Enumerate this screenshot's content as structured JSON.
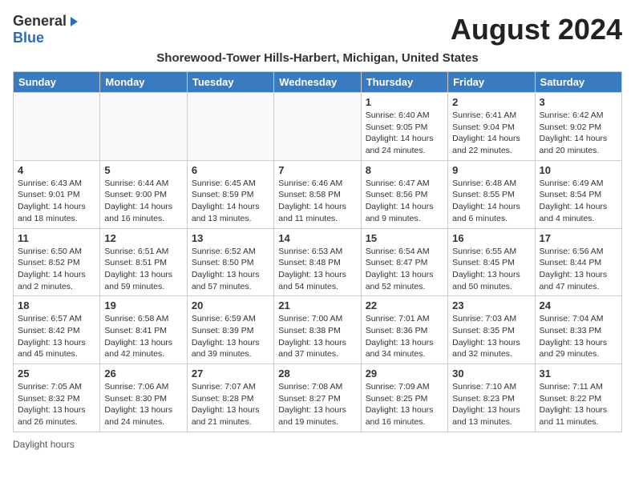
{
  "header": {
    "logo_general": "General",
    "logo_blue": "Blue",
    "month_title": "August 2024",
    "subtitle": "Shorewood-Tower Hills-Harbert, Michigan, United States"
  },
  "calendar": {
    "days_of_week": [
      "Sunday",
      "Monday",
      "Tuesday",
      "Wednesday",
      "Thursday",
      "Friday",
      "Saturday"
    ],
    "weeks": [
      [
        {
          "day": "",
          "detail": ""
        },
        {
          "day": "",
          "detail": ""
        },
        {
          "day": "",
          "detail": ""
        },
        {
          "day": "",
          "detail": ""
        },
        {
          "day": "1",
          "detail": "Sunrise: 6:40 AM\nSunset: 9:05 PM\nDaylight: 14 hours and 24 minutes."
        },
        {
          "day": "2",
          "detail": "Sunrise: 6:41 AM\nSunset: 9:04 PM\nDaylight: 14 hours and 22 minutes."
        },
        {
          "day": "3",
          "detail": "Sunrise: 6:42 AM\nSunset: 9:02 PM\nDaylight: 14 hours and 20 minutes."
        }
      ],
      [
        {
          "day": "4",
          "detail": "Sunrise: 6:43 AM\nSunset: 9:01 PM\nDaylight: 14 hours and 18 minutes."
        },
        {
          "day": "5",
          "detail": "Sunrise: 6:44 AM\nSunset: 9:00 PM\nDaylight: 14 hours and 16 minutes."
        },
        {
          "day": "6",
          "detail": "Sunrise: 6:45 AM\nSunset: 8:59 PM\nDaylight: 14 hours and 13 minutes."
        },
        {
          "day": "7",
          "detail": "Sunrise: 6:46 AM\nSunset: 8:58 PM\nDaylight: 14 hours and 11 minutes."
        },
        {
          "day": "8",
          "detail": "Sunrise: 6:47 AM\nSunset: 8:56 PM\nDaylight: 14 hours and 9 minutes."
        },
        {
          "day": "9",
          "detail": "Sunrise: 6:48 AM\nSunset: 8:55 PM\nDaylight: 14 hours and 6 minutes."
        },
        {
          "day": "10",
          "detail": "Sunrise: 6:49 AM\nSunset: 8:54 PM\nDaylight: 14 hours and 4 minutes."
        }
      ],
      [
        {
          "day": "11",
          "detail": "Sunrise: 6:50 AM\nSunset: 8:52 PM\nDaylight: 14 hours and 2 minutes."
        },
        {
          "day": "12",
          "detail": "Sunrise: 6:51 AM\nSunset: 8:51 PM\nDaylight: 13 hours and 59 minutes."
        },
        {
          "day": "13",
          "detail": "Sunrise: 6:52 AM\nSunset: 8:50 PM\nDaylight: 13 hours and 57 minutes."
        },
        {
          "day": "14",
          "detail": "Sunrise: 6:53 AM\nSunset: 8:48 PM\nDaylight: 13 hours and 54 minutes."
        },
        {
          "day": "15",
          "detail": "Sunrise: 6:54 AM\nSunset: 8:47 PM\nDaylight: 13 hours and 52 minutes."
        },
        {
          "day": "16",
          "detail": "Sunrise: 6:55 AM\nSunset: 8:45 PM\nDaylight: 13 hours and 50 minutes."
        },
        {
          "day": "17",
          "detail": "Sunrise: 6:56 AM\nSunset: 8:44 PM\nDaylight: 13 hours and 47 minutes."
        }
      ],
      [
        {
          "day": "18",
          "detail": "Sunrise: 6:57 AM\nSunset: 8:42 PM\nDaylight: 13 hours and 45 minutes."
        },
        {
          "day": "19",
          "detail": "Sunrise: 6:58 AM\nSunset: 8:41 PM\nDaylight: 13 hours and 42 minutes."
        },
        {
          "day": "20",
          "detail": "Sunrise: 6:59 AM\nSunset: 8:39 PM\nDaylight: 13 hours and 39 minutes."
        },
        {
          "day": "21",
          "detail": "Sunrise: 7:00 AM\nSunset: 8:38 PM\nDaylight: 13 hours and 37 minutes."
        },
        {
          "day": "22",
          "detail": "Sunrise: 7:01 AM\nSunset: 8:36 PM\nDaylight: 13 hours and 34 minutes."
        },
        {
          "day": "23",
          "detail": "Sunrise: 7:03 AM\nSunset: 8:35 PM\nDaylight: 13 hours and 32 minutes."
        },
        {
          "day": "24",
          "detail": "Sunrise: 7:04 AM\nSunset: 8:33 PM\nDaylight: 13 hours and 29 minutes."
        }
      ],
      [
        {
          "day": "25",
          "detail": "Sunrise: 7:05 AM\nSunset: 8:32 PM\nDaylight: 13 hours and 26 minutes."
        },
        {
          "day": "26",
          "detail": "Sunrise: 7:06 AM\nSunset: 8:30 PM\nDaylight: 13 hours and 24 minutes."
        },
        {
          "day": "27",
          "detail": "Sunrise: 7:07 AM\nSunset: 8:28 PM\nDaylight: 13 hours and 21 minutes."
        },
        {
          "day": "28",
          "detail": "Sunrise: 7:08 AM\nSunset: 8:27 PM\nDaylight: 13 hours and 19 minutes."
        },
        {
          "day": "29",
          "detail": "Sunrise: 7:09 AM\nSunset: 8:25 PM\nDaylight: 13 hours and 16 minutes."
        },
        {
          "day": "30",
          "detail": "Sunrise: 7:10 AM\nSunset: 8:23 PM\nDaylight: 13 hours and 13 minutes."
        },
        {
          "day": "31",
          "detail": "Sunrise: 7:11 AM\nSunset: 8:22 PM\nDaylight: 13 hours and 11 minutes."
        }
      ]
    ]
  },
  "footer": {
    "daylight_hours_label": "Daylight hours"
  }
}
